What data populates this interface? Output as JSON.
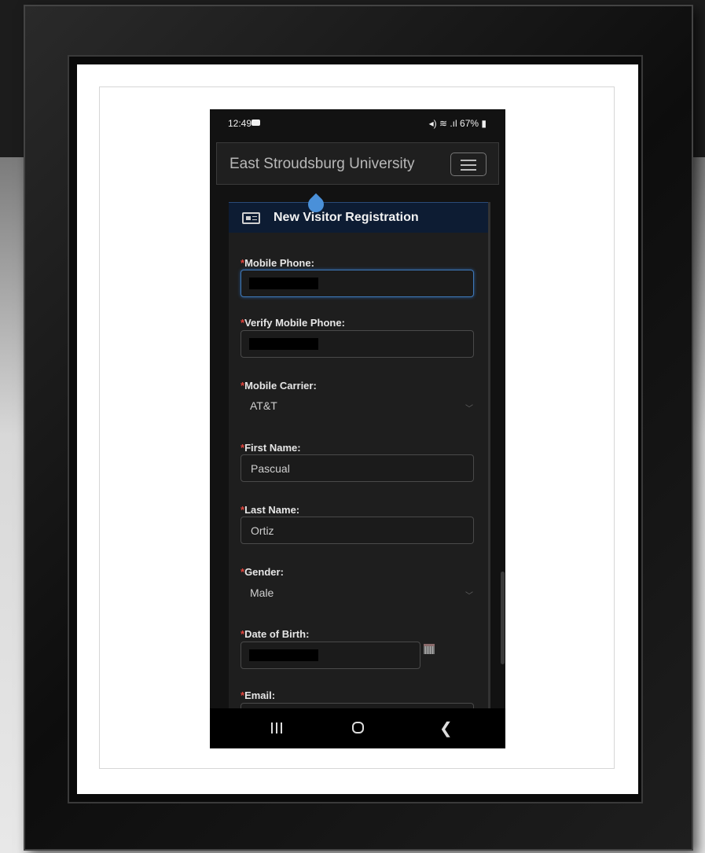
{
  "status_bar": {
    "time": "12:49",
    "battery": "67%"
  },
  "navbar": {
    "brand": "East Stroudsburg University"
  },
  "form": {
    "title": "New Visitor Registration",
    "required_mark": "*",
    "fields": {
      "mobile_phone": {
        "label": "Mobile Phone:"
      },
      "verify_mobile_phone": {
        "label": "Verify Mobile Phone:"
      },
      "mobile_carrier": {
        "label": "Mobile Carrier:",
        "value": "AT&T"
      },
      "first_name": {
        "label": "First Name:",
        "value": "Pascual"
      },
      "last_name": {
        "label": "Last Name:",
        "value": "Ortiz"
      },
      "gender": {
        "label": "Gender:",
        "value": "Male"
      },
      "date_of_birth": {
        "label": "Date of Birth:"
      },
      "email": {
        "label": "Email:"
      }
    }
  },
  "icons": {
    "form_header": "id-card-icon",
    "menu": "hamburger-menu-icon",
    "calendar": "calendar-icon",
    "select": "chevron-down-icon",
    "cursor": "text-cursor-handle-icon"
  },
  "colors": {
    "required": "#e0443c",
    "header_bg": "#0d1c33",
    "focus": "#3f78b8",
    "cursor": "#4a90d9"
  }
}
